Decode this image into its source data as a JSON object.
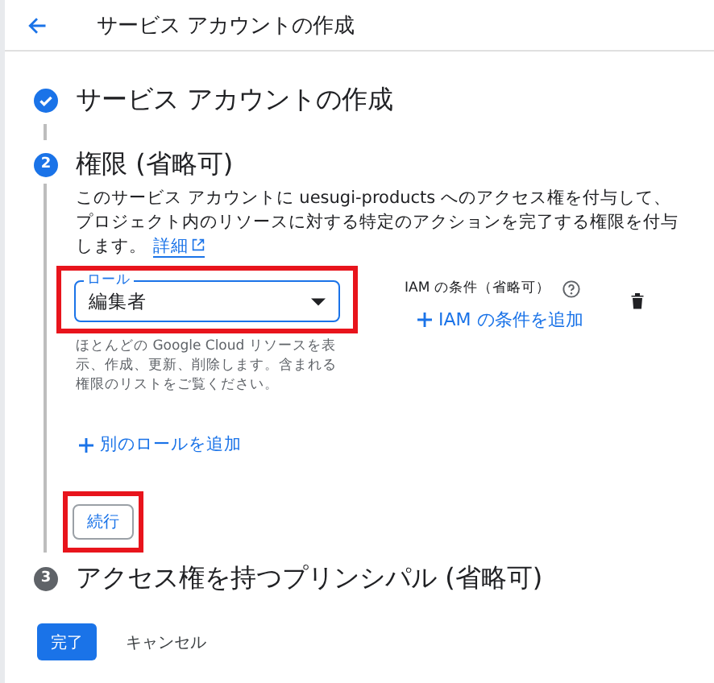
{
  "header": {
    "title": "サービス アカウントの作成"
  },
  "steps": [
    {
      "done": true,
      "title": "サービス アカウントの作成"
    },
    {
      "number": "2",
      "done": false,
      "active": true,
      "title": "権限 (省略可)"
    },
    {
      "number": "3",
      "done": false,
      "active": false,
      "title": "アクセス権を持つプリンシパル (省略可)"
    }
  ],
  "permissions": {
    "description": "このサービス アカウントに uesugi-products へのアクセス権を付与して、プロジェクト内のリソースに対する特定のアクションを完了する権限を付与します。",
    "learn_more": "詳細",
    "role_field": {
      "label": "ロール",
      "value": "編集者",
      "highlighted": true,
      "helper": "ほとんどの Google Cloud リソースを表示、作成、更新、削除します。含まれる権限のリストをご覧ください。"
    },
    "condition": {
      "label": "IAM の条件（省略可）",
      "add_button": "IAM の条件を追加"
    },
    "add_role_button": "別のロールを追加",
    "continue_button": {
      "label": "続行",
      "highlighted": true
    }
  },
  "actions": {
    "done_button": "完了",
    "cancel_button": "キャンセル"
  }
}
